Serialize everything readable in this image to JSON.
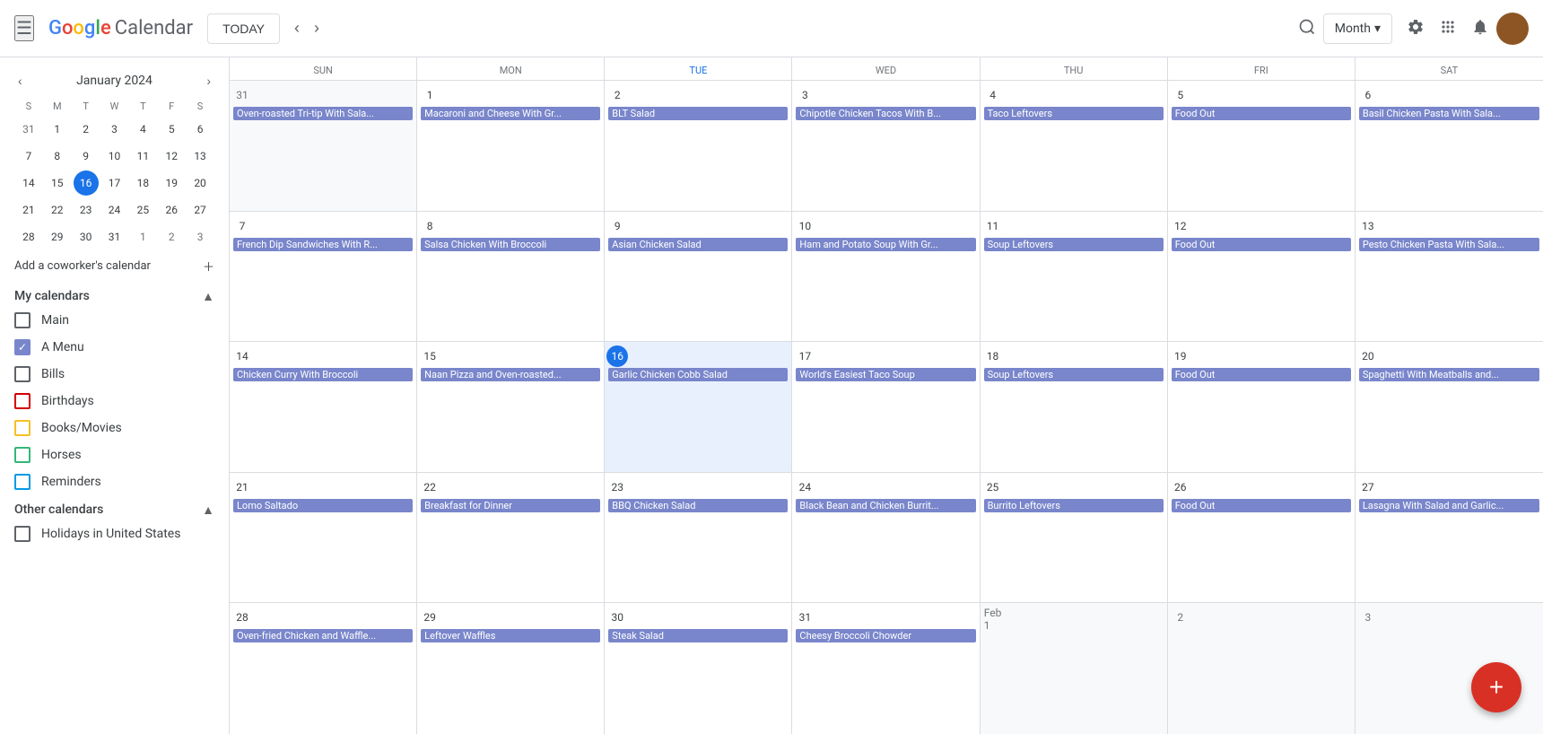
{
  "header": {
    "app_name": "Calendar",
    "today_label": "TODAY",
    "view_label": "Month",
    "view_dropdown": "▾"
  },
  "sidebar": {
    "mini_cal": {
      "month_year": "January 2024",
      "day_headers": [
        "S",
        "M",
        "T",
        "W",
        "T",
        "F",
        "S"
      ],
      "weeks": [
        [
          {
            "day": "31",
            "other": true
          },
          {
            "day": "1"
          },
          {
            "day": "2"
          },
          {
            "day": "3"
          },
          {
            "day": "4"
          },
          {
            "day": "5"
          },
          {
            "day": "6"
          }
        ],
        [
          {
            "day": "7"
          },
          {
            "day": "8"
          },
          {
            "day": "9"
          },
          {
            "day": "10"
          },
          {
            "day": "11"
          },
          {
            "day": "12"
          },
          {
            "day": "13"
          }
        ],
        [
          {
            "day": "14"
          },
          {
            "day": "15"
          },
          {
            "day": "16",
            "today": true
          },
          {
            "day": "17"
          },
          {
            "day": "18"
          },
          {
            "day": "19"
          },
          {
            "day": "20"
          }
        ],
        [
          {
            "day": "21"
          },
          {
            "day": "22"
          },
          {
            "day": "23"
          },
          {
            "day": "24"
          },
          {
            "day": "25"
          },
          {
            "day": "26"
          },
          {
            "day": "27"
          }
        ],
        [
          {
            "day": "28"
          },
          {
            "day": "29"
          },
          {
            "day": "30"
          },
          {
            "day": "31"
          },
          {
            "day": "1",
            "other": true
          },
          {
            "day": "2",
            "other": true
          },
          {
            "day": "3",
            "other": true
          }
        ]
      ]
    },
    "add_coworker_label": "Add a coworker's calendar",
    "my_calendars_label": "My calendars",
    "my_calendars": [
      {
        "label": "Main",
        "checked": false,
        "color": "blue"
      },
      {
        "label": "A Menu",
        "checked": true,
        "color": "purple"
      },
      {
        "label": "Bills",
        "checked": false,
        "color": "none"
      },
      {
        "label": "Birthdays",
        "checked": false,
        "color": "red"
      },
      {
        "label": "Books/Movies",
        "checked": false,
        "color": "yellow"
      },
      {
        "label": "Horses",
        "checked": false,
        "color": "green"
      },
      {
        "label": "Reminders",
        "checked": false,
        "color": "blue2"
      }
    ],
    "other_calendars_label": "Other calendars",
    "other_calendars": [
      {
        "label": "Holidays in United States",
        "checked": false,
        "color": "none"
      }
    ]
  },
  "calendar": {
    "day_headers": [
      {
        "name": "Sun",
        "num": "31",
        "today": false,
        "other": true
      },
      {
        "name": "Mon",
        "num": "1",
        "today": false
      },
      {
        "name": "Tue",
        "num": "2",
        "today": false
      },
      {
        "name": "Wed",
        "num": "3",
        "today": false
      },
      {
        "name": "Thu",
        "num": "4",
        "today": false
      },
      {
        "name": "Fri",
        "num": "5",
        "today": false
      },
      {
        "name": "Sat",
        "num": "6",
        "today": false
      }
    ],
    "weeks": [
      {
        "days": [
          {
            "num": "31",
            "other": true,
            "events": [
              "Oven-roasted Tri-tip With Sala..."
            ]
          },
          {
            "num": "1",
            "events": [
              "Macaroni and Cheese With Gr..."
            ]
          },
          {
            "num": "2",
            "events": [
              "BLT Salad"
            ]
          },
          {
            "num": "3",
            "events": [
              "Chipotle Chicken Tacos With B..."
            ]
          },
          {
            "num": "4",
            "events": [
              "Taco Leftovers"
            ]
          },
          {
            "num": "5",
            "events": [
              "Food Out"
            ]
          },
          {
            "num": "6",
            "events": [
              "Basil Chicken Pasta With Sala..."
            ]
          }
        ]
      },
      {
        "days": [
          {
            "num": "7",
            "events": [
              "French Dip Sandwiches With R..."
            ]
          },
          {
            "num": "8",
            "events": [
              "Salsa Chicken With Broccoli"
            ]
          },
          {
            "num": "9",
            "events": [
              "Asian Chicken Salad"
            ]
          },
          {
            "num": "10",
            "events": [
              "Ham and Potato Soup With Gr..."
            ]
          },
          {
            "num": "11",
            "events": [
              "Soup Leftovers"
            ]
          },
          {
            "num": "12",
            "events": [
              "Food Out"
            ]
          },
          {
            "num": "13",
            "events": [
              "Pesto Chicken Pasta With Sala..."
            ]
          }
        ]
      },
      {
        "days": [
          {
            "num": "14",
            "events": [
              "Chicken Curry With Broccoli"
            ]
          },
          {
            "num": "15",
            "events": [
              "Naan Pizza and Oven-roasted..."
            ]
          },
          {
            "num": "16",
            "today": true,
            "events": [
              "Garlic Chicken Cobb Salad"
            ]
          },
          {
            "num": "17",
            "events": [
              "World's Easiest Taco Soup"
            ]
          },
          {
            "num": "18",
            "events": [
              "Soup Leftovers"
            ]
          },
          {
            "num": "19",
            "events": [
              "Food Out"
            ]
          },
          {
            "num": "20",
            "events": [
              "Spaghetti With Meatballs and..."
            ]
          }
        ]
      },
      {
        "days": [
          {
            "num": "21",
            "events": [
              "Lomo Saltado"
            ]
          },
          {
            "num": "22",
            "events": [
              "Breakfast for Dinner"
            ]
          },
          {
            "num": "23",
            "events": [
              "BBQ Chicken Salad"
            ]
          },
          {
            "num": "24",
            "events": [
              "Black Bean and Chicken Burrit..."
            ]
          },
          {
            "num": "25",
            "events": [
              "Burrito Leftovers"
            ]
          },
          {
            "num": "26",
            "events": [
              "Food Out"
            ]
          },
          {
            "num": "27",
            "events": [
              "Lasagna With Salad and Garlic..."
            ]
          }
        ]
      },
      {
        "days": [
          {
            "num": "28",
            "events": [
              "Oven-fried Chicken and Waffle..."
            ]
          },
          {
            "num": "29",
            "events": [
              "Leftover Waffles"
            ]
          },
          {
            "num": "30",
            "events": [
              "Steak Salad"
            ]
          },
          {
            "num": "31",
            "events": [
              "Cheesy Broccoli Chowder"
            ]
          },
          {
            "num": "Feb 1",
            "other": true,
            "events": []
          },
          {
            "num": "2",
            "other": true,
            "events": []
          },
          {
            "num": "3",
            "other": true,
            "events": []
          }
        ]
      }
    ]
  },
  "fab": {
    "label": "+"
  }
}
